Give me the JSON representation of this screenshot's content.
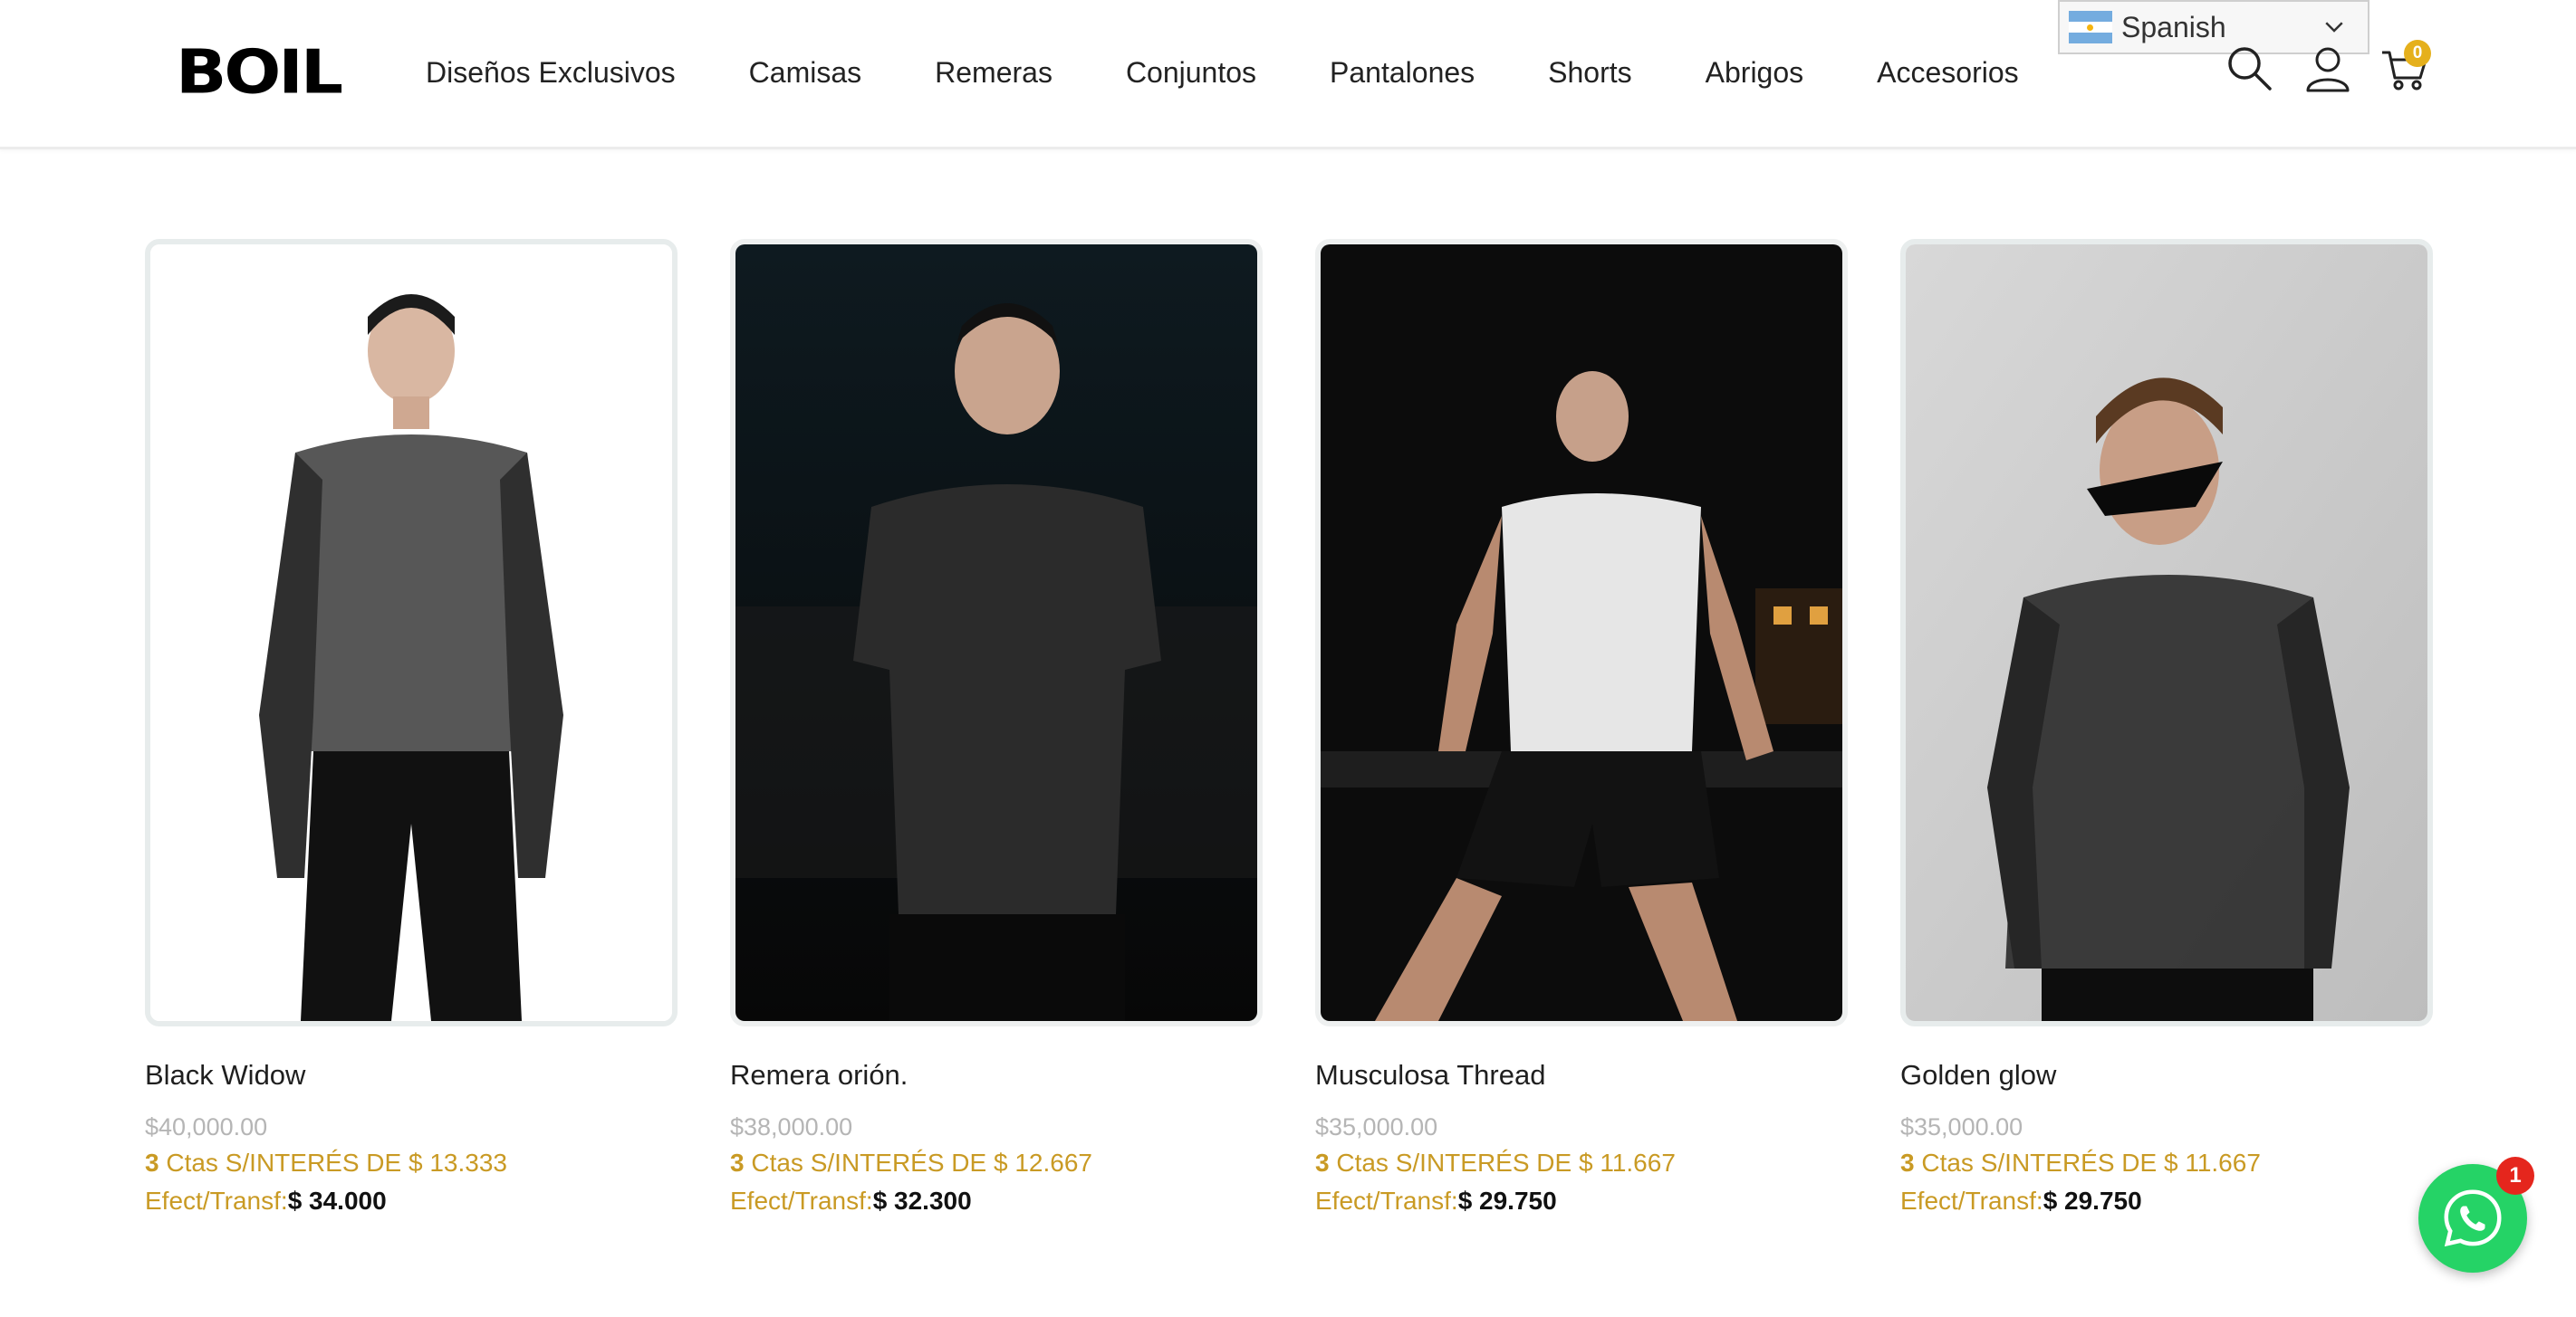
{
  "brand": {
    "logo_text": "BOIL"
  },
  "nav": {
    "items": [
      {
        "label": "Diseños Exclusivos"
      },
      {
        "label": "Camisas"
      },
      {
        "label": "Remeras"
      },
      {
        "label": "Conjuntos"
      },
      {
        "label": "Pantalones"
      },
      {
        "label": "Shorts"
      },
      {
        "label": "Abrigos"
      },
      {
        "label": "Accesorios"
      }
    ]
  },
  "language": {
    "selected": "Spanish",
    "flag_icon": "argentina-flag-icon"
  },
  "header_icons": {
    "search": "search-icon",
    "account": "user-icon",
    "cart": "cart-icon",
    "cart_count": "0"
  },
  "products": [
    {
      "name": "Black Widow",
      "old_price": "$40,000.00",
      "cuotas_num": "3",
      "cuotas_text": " Ctas S/INTERÉS DE $ 13.333",
      "efect_label": "Efect/Transf:",
      "efect_price": "$ 34.000"
    },
    {
      "name": "Remera orión.",
      "old_price": "$38,000.00",
      "cuotas_num": "3",
      "cuotas_text": " Ctas S/INTERÉS DE $ 12.667",
      "efect_label": "Efect/Transf:",
      "efect_price": "$ 32.300"
    },
    {
      "name": "Musculosa Thread",
      "old_price": "$35,000.00",
      "cuotas_num": "3",
      "cuotas_text": " Ctas S/INTERÉS DE $ 11.667",
      "efect_label": "Efect/Transf:",
      "efect_price": "$ 29.750"
    },
    {
      "name": "Golden glow",
      "old_price": "$35,000.00",
      "cuotas_num": "3",
      "cuotas_text": " Ctas S/INTERÉS DE $ 11.667",
      "efect_label": "Efect/Transf:",
      "efect_price": "$ 29.750"
    }
  ],
  "whatsapp": {
    "icon": "whatsapp-icon",
    "badge_count": "1"
  },
  "colors": {
    "accent_gold": "#c99a24",
    "cart_badge": "#e5b01c",
    "whatsapp_green": "#25d366",
    "badge_red": "#e5261d"
  }
}
